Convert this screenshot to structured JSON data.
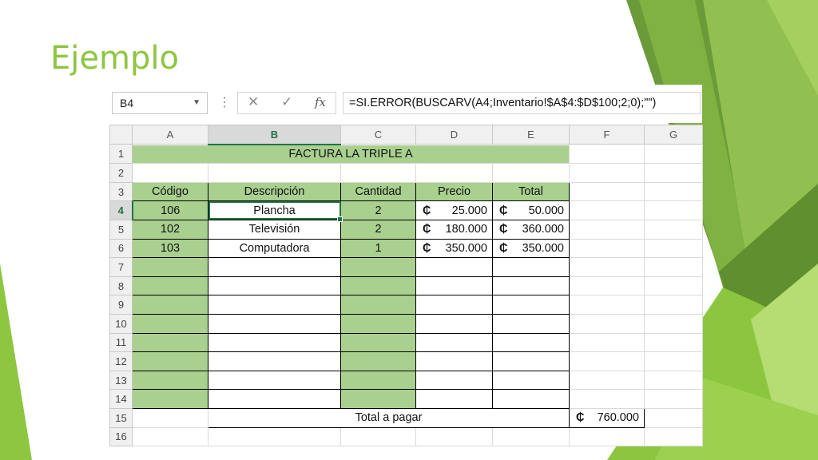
{
  "slide": {
    "title": "Ejemplo",
    "accent_color": "#8dc63f"
  },
  "formula_bar": {
    "name_box": "B4",
    "icons": [
      "cancel-x-icon",
      "confirm-check-icon",
      "function-fx-icon"
    ],
    "fx_label": "fx",
    "formula": "=SI.ERROR(BUSCARV(A4;Inventario!$A$4:$D$100;2;0);\"\")"
  },
  "sheet": {
    "columns": [
      "A",
      "B",
      "C",
      "D",
      "E",
      "F",
      "G"
    ],
    "selected_column": "B",
    "selected_row": "4",
    "rows": [
      "1",
      "2",
      "3",
      "4",
      "5",
      "6",
      "7",
      "8",
      "9",
      "10",
      "11",
      "12",
      "13",
      "14",
      "15",
      "16"
    ],
    "banner": "FACTURA LA TRIPLE A",
    "headers": {
      "codigo": "Código",
      "descripcion": "Descripción",
      "cantidad": "Cantidad",
      "precio": "Precio",
      "total": "Total"
    },
    "currency_symbol": "₵",
    "items": [
      {
        "codigo": "106",
        "descripcion": "Plancha",
        "cantidad": "2",
        "precio": "25.000",
        "total": "50.000"
      },
      {
        "codigo": "102",
        "descripcion": "Televisión",
        "cantidad": "2",
        "precio": "180.000",
        "total": "360.000"
      },
      {
        "codigo": "103",
        "descripcion": "Computadora",
        "cantidad": "1",
        "precio": "350.000",
        "total": "350.000"
      }
    ],
    "total_label": "Total a pagar",
    "grand_total": "760.000",
    "header_fill_color": "#a9d08e",
    "selection_color": "#217346"
  }
}
